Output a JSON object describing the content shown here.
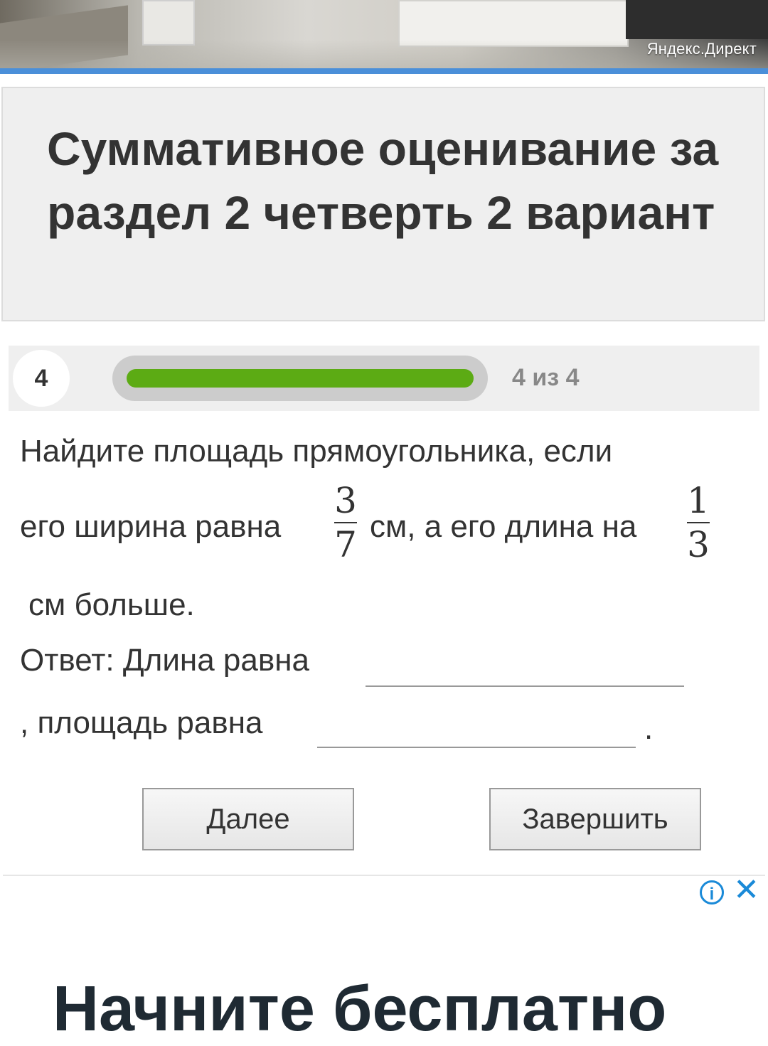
{
  "top_ad": {
    "brand": "Яндекс.Директ"
  },
  "title": "Суммативное оценивание за раздел 2 четверть 2 вариант",
  "progress": {
    "question_number": "4",
    "text": "4 из 4",
    "fraction": 1.0
  },
  "question": {
    "line1": "Найдите площадь прямоугольника, если",
    "line2a": "его ширина равна",
    "frac1": {
      "num": "3",
      "den": "7"
    },
    "line2b": "см, а его длина на",
    "frac2": {
      "num": "1",
      "den": "3"
    },
    "line3": "см больше."
  },
  "answer": {
    "label1": "Ответ: Длина равна",
    "label2": ",  площадь равна",
    "end": "."
  },
  "buttons": {
    "next": "Далее",
    "finish": "Завершить"
  },
  "bottom_ad": {
    "info": "i",
    "close": "✕",
    "headline": "Начните бесплатно"
  },
  "colors": {
    "progress_fill": "#5cab14",
    "accent_blue": "#4a8fd9",
    "ad_icon": "#1a8ad8"
  }
}
